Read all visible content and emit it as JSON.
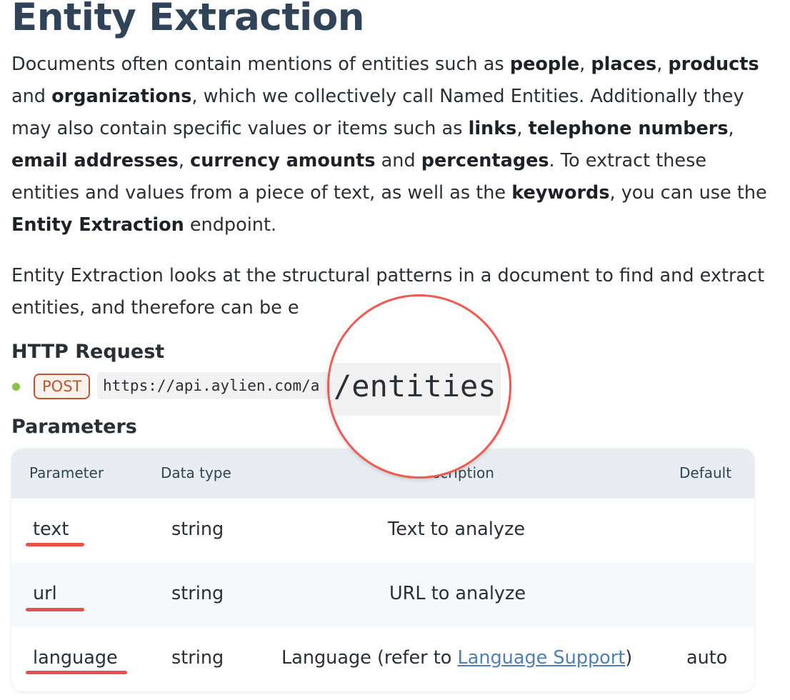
{
  "page": {
    "title": "Entity Extraction",
    "intro": {
      "t1": "Documents often contain mentions of entities such as ",
      "b1": "people",
      "t2": ", ",
      "b2": "places",
      "t3": ", ",
      "b3": "products",
      "t4": " and ",
      "b4": "organizations",
      "t5": ", which we collectively call Named Entities. Additionally they may also contain specific values or items such as ",
      "b5": "links",
      "t6": ", ",
      "b6": "telephone numbers",
      "t7": ", ",
      "b7": "email addresses",
      "t8": ", ",
      "b8": "currency amounts",
      "t9": " and ",
      "b9": "percentages",
      "t10": ". To extract these entities and values from a piece of text, as well as the ",
      "b10": "keywords",
      "t11": ", you can use the ",
      "b11": "Entity Extraction",
      "t12": " endpoint."
    },
    "para2": "Entity Extraction looks at the structural patterns in a document to find and extract entities, and therefore can be e"
  },
  "http_request": {
    "heading": "HTTP Request",
    "method": "POST",
    "url": "https://api.aylien.com/a",
    "magnified_text": "/entities"
  },
  "parameters": {
    "heading": "Parameters",
    "headers": {
      "parameter": "Parameter",
      "data_type": "Data type",
      "description": "Description",
      "default": "Default"
    },
    "rows": [
      {
        "name": "text",
        "type": "string",
        "description": "Text to analyze",
        "default": ""
      },
      {
        "name": "url",
        "type": "string",
        "description": "URL to analyze",
        "default": ""
      },
      {
        "name": "language",
        "type": "string",
        "description_prefix": "Language (refer to ",
        "description_link": "Language Support",
        "description_suffix": ")",
        "default": "auto"
      }
    ]
  },
  "colors": {
    "title": "#2f4458",
    "method_badge": "#c0532d",
    "highlight": "#e9514a",
    "link": "#4f7fb5",
    "bullet": "#8bc34a"
  }
}
